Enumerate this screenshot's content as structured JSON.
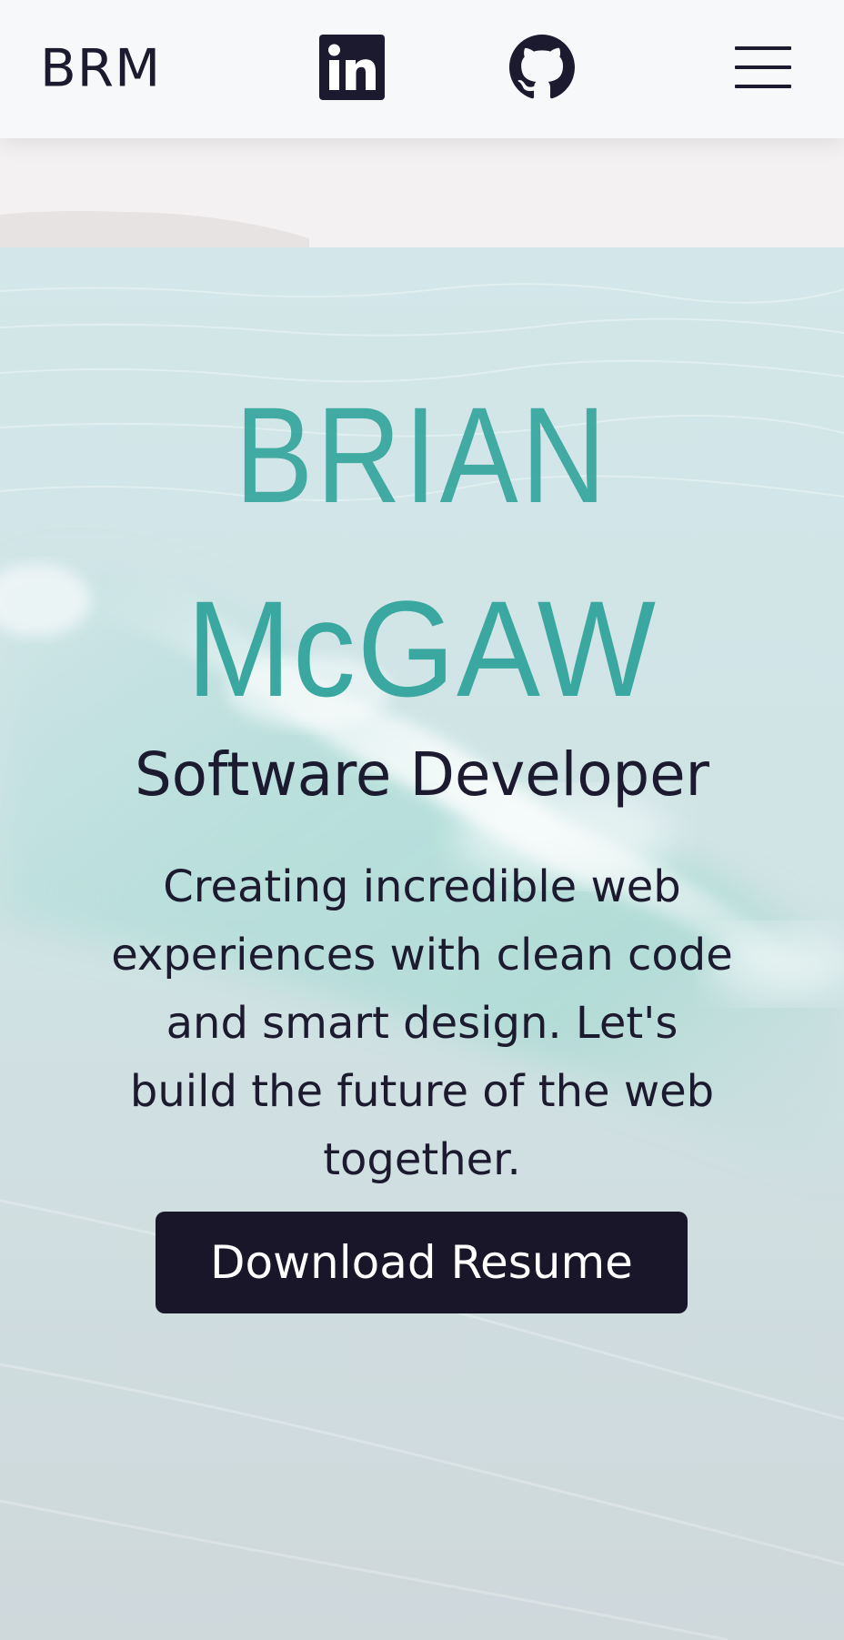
{
  "navbar": {
    "brand": "BRM",
    "linkedin_icon": "linkedin-icon",
    "github_icon": "github-icon",
    "menu_icon": "hamburger-menu-icon"
  },
  "hero": {
    "first_name": "BRIAN",
    "last_name": "McGAW",
    "subtitle": "Software Developer",
    "tagline": "Creating incredible web experiences with clean code and smart design. Let's build the future of the web together.",
    "cta_label": "Download Resume",
    "background": "ocean-wave-photo"
  },
  "colors": {
    "accent": "#3aa8a0",
    "dark": "#181628",
    "navbar_bg": "#f7f8fa"
  }
}
